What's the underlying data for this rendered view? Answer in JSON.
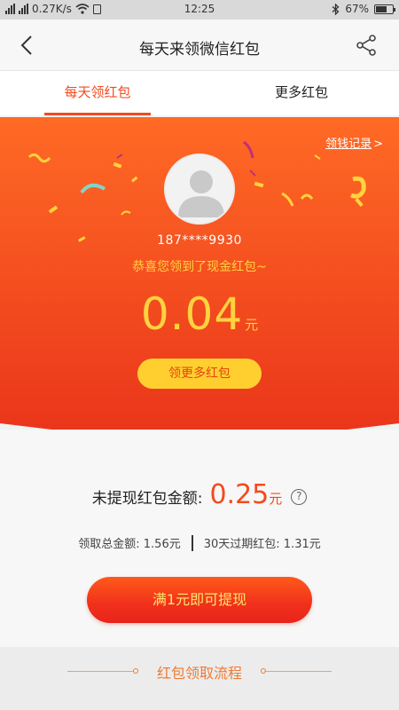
{
  "status_bar": {
    "network_speed": "0.27K/s",
    "time": "12:25",
    "battery": "67%",
    "battery_level": 0.67,
    "icons": [
      "signal-icon",
      "wifi-icon",
      "bluetooth-icon",
      "battery-icon"
    ]
  },
  "nav": {
    "title": "每天来领微信红包",
    "back_icon": "back-arrow-icon",
    "share_icon": "share-icon"
  },
  "tabs": [
    {
      "label": "每天领红包",
      "active": true
    },
    {
      "label": "更多红包",
      "active": false
    }
  ],
  "card": {
    "record_link": "领钱记录",
    "record_arrow": ">",
    "phone": "187****9930",
    "congrats": "恭喜您领到了现金红包~",
    "amount": "0.04",
    "amount_unit": "元",
    "more_button": "领更多红包"
  },
  "balance": {
    "label": "未提现红包金额:",
    "value": "0.25",
    "unit": "元",
    "help_symbol": "?"
  },
  "stats": {
    "total_label": "领取总金额: 1.56元",
    "expire_label": "30天过期红包: 1.31元"
  },
  "withdraw_button": "满1元即可提现",
  "footer": {
    "flow_title": "红包领取流程"
  },
  "colors": {
    "accent": "#f24b1d",
    "gold": "#ffd23f",
    "card_top": "#ff6a25",
    "card_bottom": "#e9331a"
  }
}
